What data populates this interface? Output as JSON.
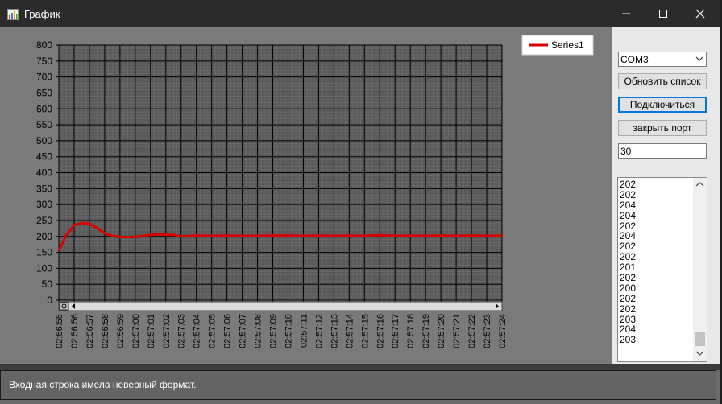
{
  "window": {
    "title": "График",
    "icons": {
      "app": "chart-app-icon",
      "minimize": "minimize-icon",
      "maximize": "maximize-icon",
      "close": "close-icon"
    }
  },
  "controls": {
    "port_select": {
      "value": "COM3",
      "arrow_icon": "chevron-down-icon"
    },
    "refresh_label": "Обновить список",
    "connect_label": "Подключиться",
    "close_port_label": "закрыть порт",
    "count_input": {
      "value": "30"
    }
  },
  "received_list": [
    "202",
    "202",
    "204",
    "204",
    "202",
    "204",
    "202",
    "202",
    "201",
    "202",
    "200",
    "202",
    "202",
    "203",
    "204",
    "203"
  ],
  "status": {
    "message": "Входная строка имела неверный формат."
  },
  "colors": {
    "series": "#d80000",
    "plot_bg": "#5a5a5a",
    "chart_bg": "#7a7a7a",
    "accent_focus": "#0078d7"
  },
  "chart_data": {
    "type": "line",
    "legend": {
      "entries": [
        "Series1"
      ],
      "position": "top-right"
    },
    "x": [
      "02:56:55",
      "02:56:56",
      "02:56:57",
      "02:56:58",
      "02:56:59",
      "02:57:00",
      "02:57:01",
      "02:57:02",
      "02:57:03",
      "02:57:04",
      "02:57:05",
      "02:57:06",
      "02:57:07",
      "02:57:08",
      "02:57:09",
      "02:57:10",
      "02:57:11",
      "02:57:12",
      "02:57:13",
      "02:57:14",
      "02:57:15",
      "02:57:16",
      "02:57:17",
      "02:57:18",
      "02:57:19",
      "02:57:20",
      "02:57:21",
      "02:57:22",
      "02:57:23",
      "02:57:24"
    ],
    "ylim": [
      0,
      800
    ],
    "y_ticks": [
      0,
      50,
      100,
      150,
      200,
      250,
      300,
      350,
      400,
      450,
      500,
      550,
      600,
      650,
      700,
      750,
      800
    ],
    "grid": true,
    "series": [
      {
        "name": "Series1",
        "points": [
          [
            0,
            155
          ],
          [
            0.5,
            205
          ],
          [
            1,
            235
          ],
          [
            1.5,
            242
          ],
          [
            2,
            240
          ],
          [
            2.5,
            226
          ],
          [
            3,
            210
          ],
          [
            3.5,
            202
          ],
          [
            4,
            198
          ],
          [
            5,
            198
          ],
          [
            6,
            205
          ],
          [
            6.5,
            207
          ],
          [
            7,
            205
          ],
          [
            7.5,
            205
          ],
          [
            8,
            200
          ],
          [
            9,
            203
          ],
          [
            10,
            202
          ],
          [
            11,
            203
          ],
          [
            12,
            202
          ],
          [
            13,
            202
          ],
          [
            14,
            203
          ],
          [
            15,
            203
          ],
          [
            16,
            202
          ],
          [
            17,
            203
          ],
          [
            18,
            202
          ],
          [
            19,
            203
          ],
          [
            20,
            202
          ],
          [
            21,
            204
          ],
          [
            22,
            202
          ],
          [
            23,
            203
          ],
          [
            24,
            202
          ],
          [
            25,
            203
          ],
          [
            26,
            202
          ],
          [
            27,
            203
          ],
          [
            28,
            202
          ],
          [
            29,
            203
          ]
        ]
      }
    ]
  }
}
